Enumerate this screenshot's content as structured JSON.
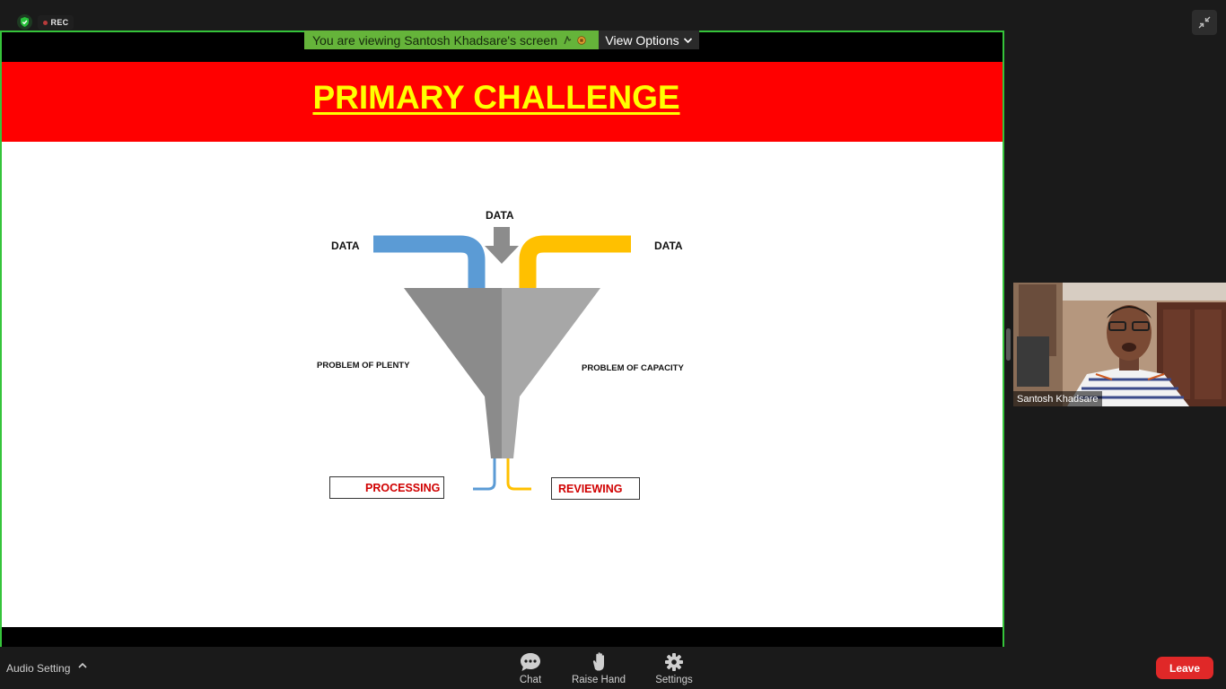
{
  "top_bar": {
    "security_icon": "shield-check-icon",
    "recording_label": "REC",
    "exit_fullscreen_icon": "exit-fullscreen-icon"
  },
  "share_banner": {
    "viewing_text": "You are viewing Santosh Khadsare's screen",
    "view_options_label": "View Options",
    "border_color": "#35c43a",
    "banner_color": "#65b43a"
  },
  "slide": {
    "title": "PRIMARY CHALLENGE",
    "header_color": "#ff0000",
    "title_color": "#ffff00",
    "data_top": "DATA",
    "data_left": "DATA",
    "data_right": "DATA",
    "problem_left": "PROBLEM OF PLENTY",
    "problem_right": "PROBLEM OF CAPACITY",
    "output_left": "PROCESSING",
    "output_right": "REVIEWING",
    "pipe_left_color": "#5b9bd5",
    "pipe_right_color": "#ffc000",
    "funnel_color": "#8c8c8c"
  },
  "participant": {
    "name": "Santosh Khadsare"
  },
  "bottom_bar": {
    "audio_setting_label": "Audio Setting",
    "chat_label": "Chat",
    "raise_hand_label": "Raise Hand",
    "settings_label": "Settings",
    "leave_label": "Leave",
    "leave_color": "#e02828"
  }
}
